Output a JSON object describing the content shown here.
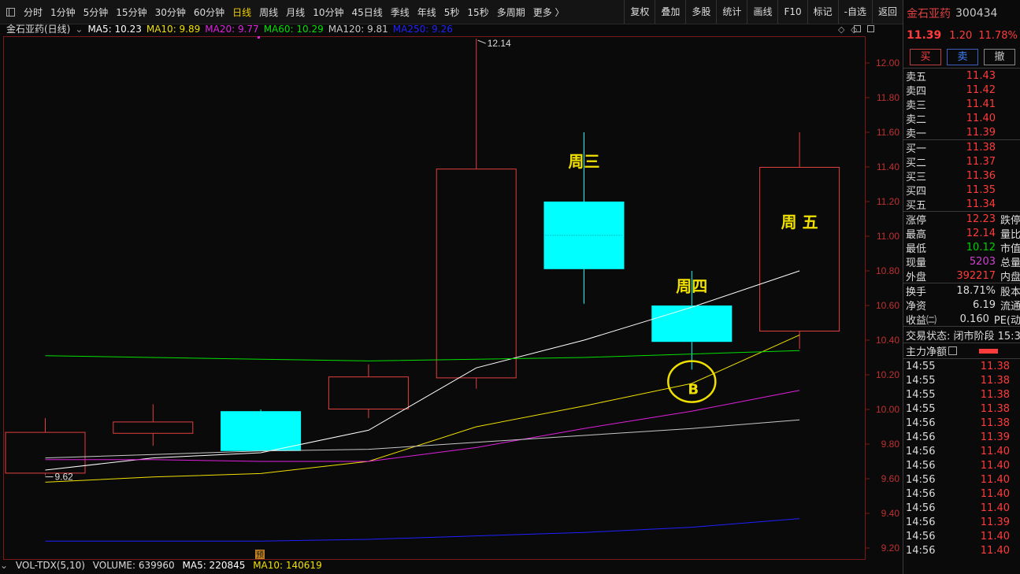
{
  "toolbar": {
    "periods": [
      "分时",
      "1分钟",
      "5分钟",
      "15分钟",
      "30分钟",
      "60分钟",
      "日线",
      "周线",
      "月线",
      "10分钟",
      "45日线",
      "季线",
      "年线",
      "5秒",
      "15秒",
      "多周期",
      "更多 〉"
    ],
    "active_period": "日线",
    "tools": [
      "复权",
      "叠加",
      "多股",
      "统计",
      "画线",
      "F10",
      "标记",
      "-自选",
      "返回"
    ]
  },
  "ma_bar": {
    "title": "金石亚药(日线)",
    "items": [
      {
        "label": "MA5: 10.23",
        "color": "#ffffff"
      },
      {
        "label": "MA10: 9.89",
        "color": "#f0e000"
      },
      {
        "label": "MA20: 9.77",
        "color": "#e020e0"
      },
      {
        "label": "MA60: 10.29",
        "color": "#00e000"
      },
      {
        "label": "MA120: 9.81",
        "color": "#c8c8c8"
      },
      {
        "label": "MA250: 9.26",
        "color": "#2020ff"
      }
    ]
  },
  "chart_data": {
    "type": "candlestick",
    "ylim": [
      9.13,
      12.27
    ],
    "y_ticks": [
      "12.00",
      "11.80",
      "11.60",
      "11.40",
      "11.20",
      "11.00",
      "10.80",
      "10.60",
      "10.40",
      "10.20",
      "10.00",
      "9.80",
      "9.60",
      "9.40",
      "9.20"
    ],
    "candles": [
      {
        "open": 9.87,
        "high": 9.95,
        "low": 9.62,
        "close": 9.63,
        "style": "down-hollow"
      },
      {
        "open": 9.93,
        "high": 10.03,
        "low": 9.79,
        "close": 9.86,
        "style": "down-hollow"
      },
      {
        "open": 9.99,
        "high": 10.0,
        "low": 9.76,
        "close": 9.76,
        "style": "down-solid"
      },
      {
        "open": 10.19,
        "high": 10.26,
        "low": 9.95,
        "close": 10.0,
        "style": "down-hollow"
      },
      {
        "open": 10.18,
        "high": 12.14,
        "low": 10.12,
        "close": 11.39,
        "style": "up-hollow"
      },
      {
        "open": 11.2,
        "high": 11.6,
        "low": 10.61,
        "close": 10.81,
        "style": "down-solid"
      },
      {
        "open": 10.6,
        "high": 10.8,
        "low": 10.23,
        "close": 10.39,
        "style": "down-solid"
      },
      {
        "open": 10.45,
        "high": 11.6,
        "low": 10.35,
        "close": 11.4,
        "style": "up-hollow"
      }
    ],
    "ma_lines": [
      {
        "name": "MA5",
        "color": "#ffffff",
        "values": [
          9.65,
          9.72,
          9.75,
          9.88,
          10.24,
          10.4,
          10.59,
          10.8
        ]
      },
      {
        "name": "MA10",
        "color": "#f0e000",
        "values": [
          9.58,
          9.61,
          9.63,
          9.7,
          9.9,
          10.02,
          10.15,
          10.43
        ]
      },
      {
        "name": "MA20",
        "color": "#e020e0",
        "values": [
          9.71,
          9.71,
          9.7,
          9.7,
          9.78,
          9.89,
          9.99,
          10.11
        ]
      },
      {
        "name": "MA60",
        "color": "#00e000",
        "values": [
          10.31,
          10.3,
          10.29,
          10.28,
          10.29,
          10.3,
          10.32,
          10.34
        ]
      },
      {
        "name": "MA120",
        "color": "#c8c8c8",
        "values": [
          9.72,
          9.74,
          9.76,
          9.77,
          9.81,
          9.85,
          9.89,
          9.94
        ]
      },
      {
        "name": "MA250",
        "color": "#2020ff",
        "values": [
          9.24,
          9.24,
          9.24,
          9.25,
          9.27,
          9.29,
          9.32,
          9.37
        ]
      }
    ],
    "annotations": [
      {
        "text": "周三",
        "candle": 5,
        "at": 11.4
      },
      {
        "text": "周四",
        "candle": 6,
        "at": 10.68
      },
      {
        "text": "周 五",
        "candle": 7,
        "at": 11.05
      },
      {
        "text": "B",
        "candle": 6,
        "at": 10.17
      }
    ],
    "high_label": "12.14",
    "low_label": "9.62",
    "pre_marker": "预"
  },
  "volume_bar": {
    "label": "VOL-TDX(5,10)",
    "volume": "VOLUME: 639960",
    "ma5": "MA5: 220845",
    "ma10": "MA10: 140619"
  },
  "quote": {
    "name": "金石亚药",
    "code": "300434",
    "price": "11.39",
    "change": "1.20",
    "pct": "11.78%",
    "buttons": [
      "买",
      "卖",
      "撤"
    ],
    "asks": [
      {
        "l": "卖五",
        "v": "11.43"
      },
      {
        "l": "卖四",
        "v": "11.42"
      },
      {
        "l": "卖三",
        "v": "11.41"
      },
      {
        "l": "卖二",
        "v": "11.40"
      },
      {
        "l": "卖一",
        "v": "11.39"
      }
    ],
    "bids": [
      {
        "l": "买一",
        "v": "11.38"
      },
      {
        "l": "买二",
        "v": "11.37"
      },
      {
        "l": "买三",
        "v": "11.36"
      },
      {
        "l": "买四",
        "v": "11.35"
      },
      {
        "l": "买五",
        "v": "11.34"
      }
    ],
    "stats1": [
      {
        "l": "涨停",
        "v": "12.23",
        "c": "red",
        "l2": "跌停"
      },
      {
        "l": "最高",
        "v": "12.14",
        "c": "red",
        "l2": "量比"
      },
      {
        "l": "最低",
        "v": "10.12",
        "c": "green",
        "l2": "市值"
      },
      {
        "l": "现量",
        "v": "5203",
        "c": "purple",
        "l2": "总量"
      },
      {
        "l": "外盘",
        "v": "392217",
        "c": "red",
        "l2": "内盘"
      }
    ],
    "stats2": [
      {
        "l": "换手",
        "v": "18.71%",
        "c": "white",
        "l2": "股本"
      },
      {
        "l": "净资",
        "v": "6.19",
        "c": "white",
        "l2": "流通"
      },
      {
        "l": "收益㈡",
        "v": "0.160",
        "c": "white",
        "l2": "PE(动"
      }
    ],
    "status": "交易状态: 闭市阶段 15:3",
    "flow_label": "主力净额",
    "ticks": [
      {
        "t": "14:55",
        "p": "11.38"
      },
      {
        "t": "14:55",
        "p": "11.38"
      },
      {
        "t": "14:55",
        "p": "11.38"
      },
      {
        "t": "14:55",
        "p": "11.38"
      },
      {
        "t": "14:56",
        "p": "11.38"
      },
      {
        "t": "14:56",
        "p": "11.39"
      },
      {
        "t": "14:56",
        "p": "11.40"
      },
      {
        "t": "14:56",
        "p": "11.40"
      },
      {
        "t": "14:56",
        "p": "11.40"
      },
      {
        "t": "14:56",
        "p": "11.40"
      },
      {
        "t": "14:56",
        "p": "11.40"
      },
      {
        "t": "14:56",
        "p": "11.39"
      },
      {
        "t": "14:56",
        "p": "11.40"
      },
      {
        "t": "14:56",
        "p": "11.40"
      }
    ]
  }
}
